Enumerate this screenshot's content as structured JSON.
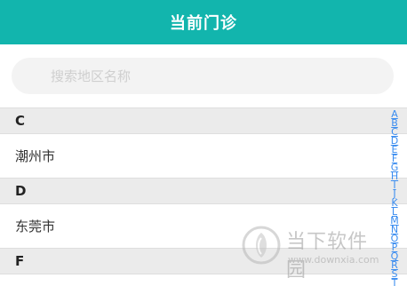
{
  "header": {
    "title": "当前门诊"
  },
  "search": {
    "placeholder": "搜索地区名称",
    "value": ""
  },
  "sections": [
    {
      "letter": "C",
      "cities": [
        "潮州市"
      ]
    },
    {
      "letter": "D",
      "cities": [
        "东莞市"
      ]
    },
    {
      "letter": "F",
      "cities": []
    }
  ],
  "index_letters": [
    "A",
    "B",
    "C",
    "D",
    "E",
    "F",
    "G",
    "H",
    "I",
    "J",
    "K",
    "L",
    "M",
    "N",
    "O",
    "P",
    "Q",
    "R",
    "S",
    "T"
  ],
  "watermark": {
    "title": "当下软件园",
    "url": "www.downxia.com"
  },
  "colors": {
    "header_bg": "#12b5ad",
    "index_color": "#3b8df0",
    "section_bg": "#ebebeb"
  }
}
